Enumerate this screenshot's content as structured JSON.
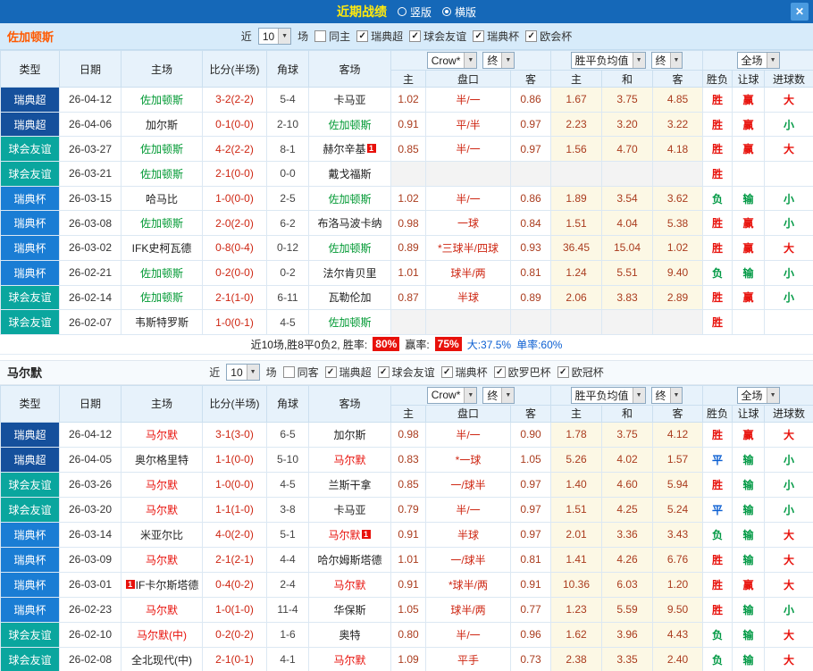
{
  "titlebar": {
    "title": "近期战绩",
    "layout_options": [
      {
        "label": "竖版",
        "selected": false
      },
      {
        "label": "横版",
        "selected": true
      }
    ],
    "close_label": "✕"
  },
  "table_header": {
    "type": "类型",
    "date": "日期",
    "home": "主场",
    "score": "比分(半场)",
    "corner": "角球",
    "away": "客场",
    "odds_source": "Crow*",
    "odds_final": "终",
    "odds_home": "主",
    "odds_handicap": "盘口",
    "odds_away": "客",
    "euro_source": "胜平负均值",
    "euro_final": "终",
    "euro_home": "主",
    "euro_draw": "和",
    "euro_away": "客",
    "scope": "全场",
    "result": "胜负",
    "handicap_result": "让球",
    "goals": "进球数"
  },
  "colors": {
    "type_badges": {
      "瑞典超": "#15509C",
      "球会友谊": "#0AA69E",
      "瑞典杯": "#1A7DD4"
    },
    "results": {
      "胜": "#E8110B",
      "负": "#009944",
      "平": "#0C5FD2",
      "赢": "#E8110B",
      "输": "#009944",
      "大": "#E8110B",
      "小": "#009944"
    }
  },
  "sections": [
    {
      "team": "佐加顿斯",
      "focus_color": "#009933",
      "filter": {
        "near": "近",
        "count": "10",
        "games": "场",
        "checkboxes": [
          {
            "label": "同主",
            "checked": false
          },
          {
            "label": "瑞典超",
            "checked": true
          },
          {
            "label": "球会友谊",
            "checked": true
          },
          {
            "label": "瑞典杯",
            "checked": true
          },
          {
            "label": "欧会杯",
            "checked": true
          }
        ]
      },
      "rows": [
        {
          "type": "瑞典超",
          "date": "26-04-12",
          "home": "佐加顿斯",
          "home_focus": true,
          "score": "3-2(2-2)",
          "corner": "5-4",
          "away": "卡马亚",
          "odds": [
            "1.02",
            "半/一",
            "0.86"
          ],
          "euro": [
            "1.67",
            "3.75",
            "4.85"
          ],
          "res": [
            "胜",
            "赢",
            "大"
          ]
        },
        {
          "type": "瑞典超",
          "date": "26-04-06",
          "home": "加尔斯",
          "score": "0-1(0-0)",
          "corner": "2-10",
          "away": "佐加顿斯",
          "away_focus": true,
          "odds": [
            "0.91",
            "平/半",
            "0.97"
          ],
          "euro": [
            "2.23",
            "3.20",
            "3.22"
          ],
          "res": [
            "胜",
            "赢",
            "小"
          ]
        },
        {
          "type": "球会友谊",
          "date": "26-03-27",
          "home": "佐加顿斯",
          "home_focus": true,
          "score": "4-2(2-2)",
          "corner": "8-1",
          "away": "赫尔辛基",
          "away_badge": "1",
          "odds": [
            "0.85",
            "半/一",
            "0.97"
          ],
          "euro": [
            "1.56",
            "4.70",
            "4.18"
          ],
          "res": [
            "胜",
            "赢",
            "大"
          ]
        },
        {
          "type": "球会友谊",
          "date": "26-03-21",
          "home": "佐加顿斯",
          "home_focus": true,
          "score": "2-1(0-0)",
          "corner": "0-0",
          "away": "戴戈福斯",
          "odds": null,
          "euro": null,
          "res": [
            "胜",
            "",
            ""
          ]
        },
        {
          "type": "瑞典杯",
          "date": "26-03-15",
          "home": "哈马比",
          "score": "1-0(0-0)",
          "corner": "2-5",
          "away": "佐加顿斯",
          "away_focus": true,
          "odds": [
            "1.02",
            "半/一",
            "0.86"
          ],
          "euro": [
            "1.89",
            "3.54",
            "3.62"
          ],
          "res": [
            "负",
            "输",
            "小"
          ]
        },
        {
          "type": "瑞典杯",
          "date": "26-03-08",
          "home": "佐加顿斯",
          "home_focus": true,
          "score": "2-0(2-0)",
          "corner": "6-2",
          "away": "布洛马波卡纳",
          "odds": [
            "0.98",
            "一球",
            "0.84"
          ],
          "euro": [
            "1.51",
            "4.04",
            "5.38"
          ],
          "res": [
            "胜",
            "赢",
            "小"
          ]
        },
        {
          "type": "瑞典杯",
          "date": "26-03-02",
          "home": "IFK史柯瓦德",
          "score": "0-8(0-4)",
          "corner": "0-12",
          "away": "佐加顿斯",
          "away_focus": true,
          "odds": [
            "0.89",
            "*三球半/四球",
            "0.93"
          ],
          "euro": [
            "36.45",
            "15.04",
            "1.02"
          ],
          "res": [
            "胜",
            "赢",
            "大"
          ]
        },
        {
          "type": "瑞典杯",
          "date": "26-02-21",
          "home": "佐加顿斯",
          "home_focus": true,
          "score": "0-2(0-0)",
          "corner": "0-2",
          "away": "法尔肯贝里",
          "odds": [
            "1.01",
            "球半/两",
            "0.81"
          ],
          "euro": [
            "1.24",
            "5.51",
            "9.40"
          ],
          "res": [
            "负",
            "输",
            "小"
          ]
        },
        {
          "type": "球会友谊",
          "date": "26-02-14",
          "home": "佐加顿斯",
          "home_focus": true,
          "score": "2-1(1-0)",
          "corner": "6-11",
          "away": "瓦勒伦加",
          "odds": [
            "0.87",
            "半球",
            "0.89"
          ],
          "euro": [
            "2.06",
            "3.83",
            "2.89"
          ],
          "res": [
            "胜",
            "赢",
            "小"
          ]
        },
        {
          "type": "球会友谊",
          "date": "26-02-07",
          "home": "韦斯特罗斯",
          "score": "1-0(0-1)",
          "corner": "4-5",
          "away": "佐加顿斯",
          "away_focus": true,
          "odds": null,
          "euro": null,
          "res": [
            "胜",
            "",
            ""
          ]
        }
      ],
      "summary": {
        "prefix": "近10场,胜8平0负2, 胜率:",
        "win_rate": "80%",
        "handicap_label": "赢率:",
        "handicap_rate": "75%",
        "over_text": "大:37.5%",
        "single_text": "单率:60%"
      }
    },
    {
      "team": "马尔默",
      "focus_color": "#E8110B",
      "filter": {
        "near": "近",
        "count": "10",
        "games": "场",
        "checkboxes": [
          {
            "label": "同客",
            "checked": false
          },
          {
            "label": "瑞典超",
            "checked": true
          },
          {
            "label": "球会友谊",
            "checked": true
          },
          {
            "label": "瑞典杯",
            "checked": true
          },
          {
            "label": "欧罗巴杯",
            "checked": true
          },
          {
            "label": "欧冠杯",
            "checked": true
          }
        ]
      },
      "rows": [
        {
          "type": "瑞典超",
          "date": "26-04-12",
          "home": "马尔默",
          "home_focus": true,
          "score": "3-1(3-0)",
          "corner": "6-5",
          "away": "加尔斯",
          "odds": [
            "0.98",
            "半/一",
            "0.90"
          ],
          "euro": [
            "1.78",
            "3.75",
            "4.12"
          ],
          "res": [
            "胜",
            "赢",
            "大"
          ]
        },
        {
          "type": "瑞典超",
          "date": "26-04-05",
          "home": "奥尔格里特",
          "score": "1-1(0-0)",
          "corner": "5-10",
          "away": "马尔默",
          "away_focus": true,
          "odds": [
            "0.83",
            "*一球",
            "1.05"
          ],
          "euro": [
            "5.26",
            "4.02",
            "1.57"
          ],
          "res": [
            "平",
            "输",
            "小"
          ]
        },
        {
          "type": "球会友谊",
          "date": "26-03-26",
          "home": "马尔默",
          "home_focus": true,
          "score": "1-0(0-0)",
          "corner": "4-5",
          "away": "兰斯干拿",
          "odds": [
            "0.85",
            "一/球半",
            "0.97"
          ],
          "euro": [
            "1.40",
            "4.60",
            "5.94"
          ],
          "res": [
            "胜",
            "输",
            "小"
          ]
        },
        {
          "type": "球会友谊",
          "date": "26-03-20",
          "home": "马尔默",
          "home_focus": true,
          "score": "1-1(1-0)",
          "corner": "3-8",
          "away": "卡马亚",
          "odds": [
            "0.79",
            "半/一",
            "0.97"
          ],
          "euro": [
            "1.51",
            "4.25",
            "5.24"
          ],
          "res": [
            "平",
            "输",
            "小"
          ]
        },
        {
          "type": "瑞典杯",
          "date": "26-03-14",
          "home": "米亚尔比",
          "score": "4-0(2-0)",
          "corner": "5-1",
          "away": "马尔默",
          "away_focus": true,
          "away_badge": "1",
          "odds": [
            "0.91",
            "半球",
            "0.97"
          ],
          "euro": [
            "2.01",
            "3.36",
            "3.43"
          ],
          "res": [
            "负",
            "输",
            "大"
          ]
        },
        {
          "type": "瑞典杯",
          "date": "26-03-09",
          "home": "马尔默",
          "home_focus": true,
          "score": "2-1(2-1)",
          "corner": "4-4",
          "away": "哈尔姆斯塔德",
          "odds": [
            "1.01",
            "一/球半",
            "0.81"
          ],
          "euro": [
            "1.41",
            "4.26",
            "6.76"
          ],
          "res": [
            "胜",
            "输",
            "大"
          ]
        },
        {
          "type": "瑞典杯",
          "date": "26-03-01",
          "home": "IF卡尔斯塔德",
          "home_badge": "1",
          "home_badge_before": true,
          "score": "0-4(0-2)",
          "corner": "2-4",
          "away": "马尔默",
          "away_focus": true,
          "odds": [
            "0.91",
            "*球半/两",
            "0.91"
          ],
          "euro": [
            "10.36",
            "6.03",
            "1.20"
          ],
          "res": [
            "胜",
            "赢",
            "大"
          ]
        },
        {
          "type": "瑞典杯",
          "date": "26-02-23",
          "home": "马尔默",
          "home_focus": true,
          "score": "1-0(1-0)",
          "corner": "11-4",
          "away": "华保斯",
          "odds": [
            "1.05",
            "球半/两",
            "0.77"
          ],
          "euro": [
            "1.23",
            "5.59",
            "9.50"
          ],
          "res": [
            "胜",
            "输",
            "小"
          ]
        },
        {
          "type": "球会友谊",
          "date": "26-02-10",
          "home": "马尔默(中)",
          "home_focus": true,
          "score": "0-2(0-2)",
          "corner": "1-6",
          "away": "奥特",
          "odds": [
            "0.80",
            "半/一",
            "0.96"
          ],
          "euro": [
            "1.62",
            "3.96",
            "4.43"
          ],
          "res": [
            "负",
            "输",
            "大"
          ]
        },
        {
          "type": "球会友谊",
          "date": "26-02-08",
          "home": "全北现代(中)",
          "score": "2-1(0-1)",
          "corner": "4-1",
          "away": "马尔默",
          "away_focus": true,
          "odds": [
            "1.09",
            "平手",
            "0.73"
          ],
          "euro": [
            "2.38",
            "3.35",
            "2.40"
          ],
          "res": [
            "负",
            "输",
            "大"
          ]
        }
      ]
    }
  ]
}
